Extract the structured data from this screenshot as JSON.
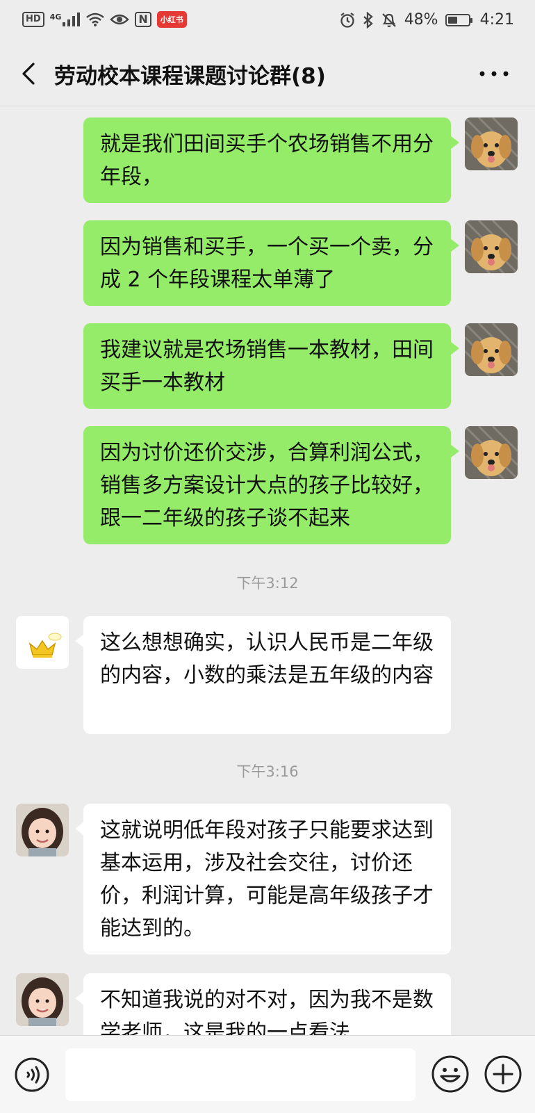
{
  "status_bar": {
    "hd": "HD",
    "network": "4G",
    "nfc": "N",
    "app_badge": "小红书",
    "battery_text": "48%",
    "battery_level": 0.48,
    "time": "4:21"
  },
  "header": {
    "title": "劳动校本课程课题讨论群(8)"
  },
  "messages": [
    {
      "sender": "me",
      "avatar": "puppy-avatar",
      "text": "就是我们田间买手个农场销售不用分年段，"
    },
    {
      "sender": "me",
      "avatar": "puppy-avatar",
      "text": "因为销售和买手，一个买一个卖，分成 2 个年段课程太单薄了"
    },
    {
      "sender": "me",
      "avatar": "puppy-avatar",
      "text": "我建议就是农场销售一本教材，田间买手一本教材"
    },
    {
      "sender": "me",
      "avatar": "puppy-avatar",
      "text": "因为讨价还价交涉，合算利润公式，销售多方案设计大点的孩子比较好，跟一二年级的孩子谈不起来"
    },
    {
      "time": "下午3:12"
    },
    {
      "sender": "other",
      "avatar": "crown-avatar",
      "text": "这么想想确实，认识人民币是二年级的内容，小数的乘法是五年级的内容"
    },
    {
      "time": "下午3:16"
    },
    {
      "sender": "other",
      "avatar": "girl-avatar",
      "text": "这就说明低年段对孩子只能要求达到基本运用，涉及社会交往，讨价还价，利润计算，可能是高年级孩子才能达到的。"
    },
    {
      "sender": "other",
      "avatar": "girl-avatar",
      "text": "不知道我说的对不对，因为我不是数学老师，这是我的一点看法"
    }
  ],
  "input": {
    "value": "",
    "placeholder": ""
  },
  "colors": {
    "my_bubble": "#95ec69",
    "other_bubble": "#ffffff",
    "background": "#ededed"
  }
}
